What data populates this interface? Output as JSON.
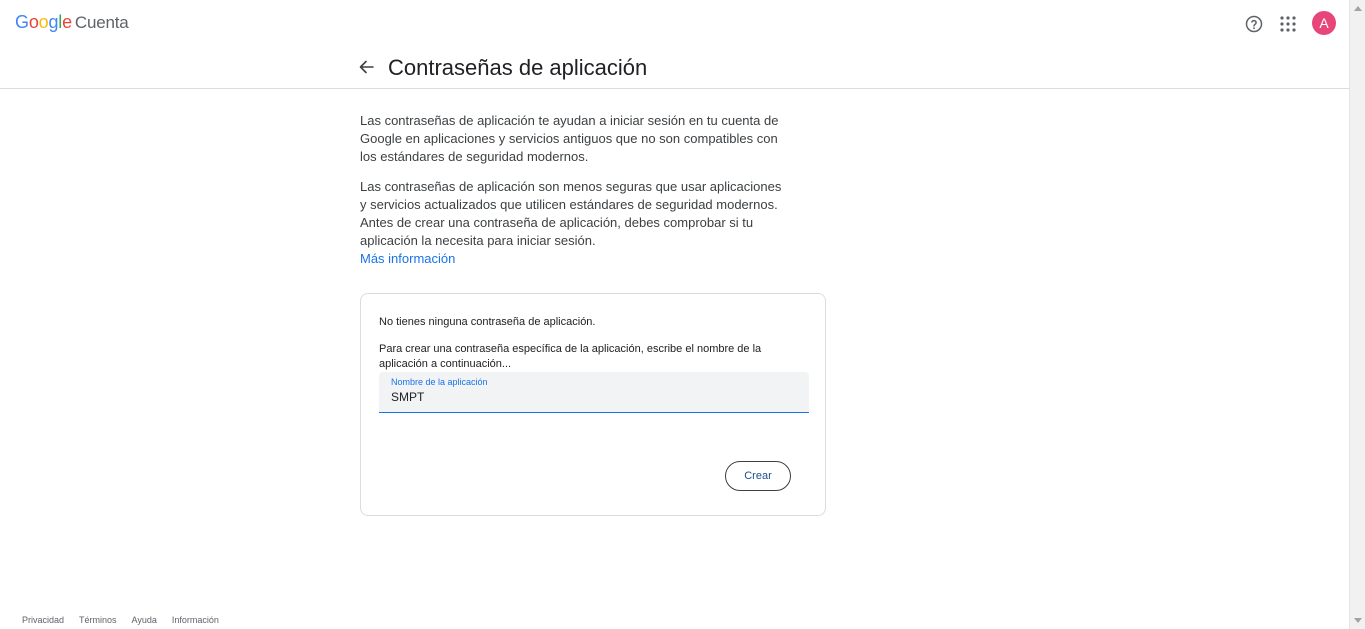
{
  "header": {
    "brand": {
      "google_letters": [
        {
          "ch": "G",
          "color": "#4285F4"
        },
        {
          "ch": "o",
          "color": "#EA4335"
        },
        {
          "ch": "o",
          "color": "#FBBC05"
        },
        {
          "ch": "g",
          "color": "#4285F4"
        },
        {
          "ch": "l",
          "color": "#34A853"
        },
        {
          "ch": "e",
          "color": "#EA4335"
        }
      ],
      "product": "Cuenta"
    },
    "help_icon": "help-circle-icon",
    "apps_icon": "apps-grid-icon",
    "avatar_initial": "A",
    "avatar_color": "#e8457a"
  },
  "page": {
    "title": "Contraseñas de aplicación",
    "back_icon": "arrow-back-icon"
  },
  "intro": {
    "paragraph1": "Las contraseñas de aplicación te ayudan a iniciar sesión en tu cuenta de Google en aplicaciones y servicios antiguos que no son compatibles con los estándares de seguridad modernos.",
    "paragraph2": "Las contraseñas de aplicación son menos seguras que usar aplicaciones y servicios actualizados que utilicen estándares de seguridad modernos. Antes de crear una contraseña de aplicación, debes comprobar si tu aplicación la necesita para iniciar sesión.",
    "learn_more": "Más información"
  },
  "card": {
    "empty_message": "No tienes ninguna contraseña de aplicación.",
    "instructions": "Para crear una contraseña específica de la aplicación, escribe el nombre de la aplicación a continuación...",
    "field_label": "Nombre de la aplicación",
    "field_value": "SMPT",
    "create_button": "Crear"
  },
  "footer": {
    "links": [
      "Privacidad",
      "Términos",
      "Ayuda",
      "Información"
    ]
  },
  "colors": {
    "accent": "#1a73e8",
    "divider": "#dadce0"
  }
}
